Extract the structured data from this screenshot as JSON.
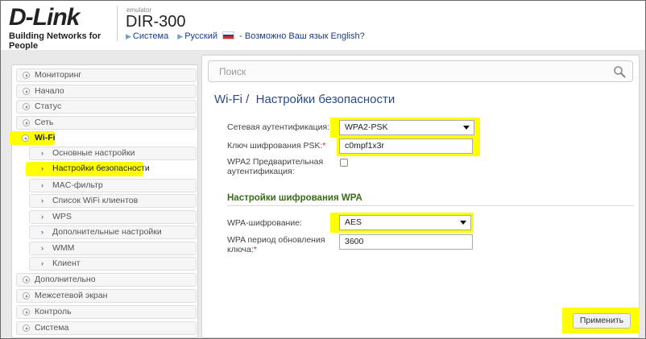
{
  "header": {
    "logo_main": "D-Link",
    "logo_sub": "Building Networks for People",
    "emulator": "emulator",
    "model": "DIR-300",
    "link_system": "Система",
    "link_language": "Русский",
    "language_prompt": "- Возможно Ваш язык English?"
  },
  "sidebar": {
    "items": [
      {
        "label": "Мониторинг"
      },
      {
        "label": "Начало"
      },
      {
        "label": "Статус"
      },
      {
        "label": "Сеть"
      },
      {
        "label": "Wi-Fi"
      },
      {
        "label": "Основные настройки"
      },
      {
        "label": "Настройки безопасности"
      },
      {
        "label": "MAC-фильтр"
      },
      {
        "label": "Список WiFi клиентов"
      },
      {
        "label": "WPS"
      },
      {
        "label": "Дополнительные настройки"
      },
      {
        "label": "WMM"
      },
      {
        "label": "Клиент"
      },
      {
        "label": "Дополнительно"
      },
      {
        "label": "Межсетевой экран"
      },
      {
        "label": "Контроль"
      },
      {
        "label": "Система"
      }
    ]
  },
  "search": {
    "placeholder": "Поиск"
  },
  "page": {
    "title_prefix": "Wi-Fi /",
    "title": "Настройки безопасности"
  },
  "form": {
    "auth_label": "Сетевая аутентификация:",
    "auth_value": "WPA2-PSK",
    "psk_label": "Ключ шифрования PSK:",
    "psk_required": "*",
    "psk_value": "c0mpf1x3r",
    "preauth_label_1": "WPA2 Предварительная",
    "preauth_label_2": "аутентификация:",
    "preauth_checked": false,
    "section_title": "Настройки шифрования WPA",
    "enc_label": "WPA-шифрование:",
    "enc_value": "AES",
    "period_label_1": "WPA период обновления",
    "period_label_2": "ключа:",
    "period_required": "*",
    "period_value": "3600",
    "apply_label": "Применить"
  },
  "colors": {
    "highlight": "#ffff00",
    "title_blue": "#2a4a8a",
    "section_green": "#3a6a1a"
  }
}
